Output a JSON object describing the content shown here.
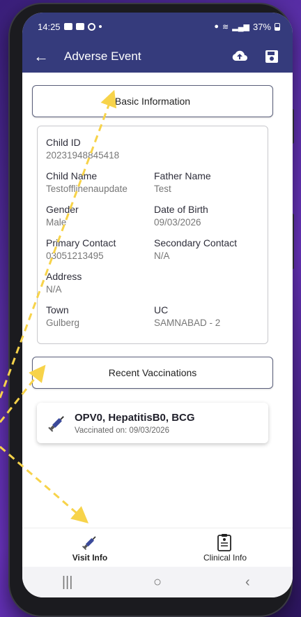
{
  "status": {
    "time": "14:25",
    "battery": "37%"
  },
  "appbar": {
    "title": "Adverse Event",
    "back_icon": "arrow-left-icon",
    "upload_icon": "cloud-upload-icon",
    "save_icon": "save-icon"
  },
  "basic_info": {
    "button_label": "Basic Information",
    "fields": {
      "child_id": {
        "label": "Child ID",
        "value": "20231948845418"
      },
      "child_name": {
        "label": "Child Name",
        "value": "Testofflinenaupdate"
      },
      "father_name": {
        "label": "Father Name",
        "value": "Test"
      },
      "gender": {
        "label": "Gender",
        "value": "Male"
      },
      "dob": {
        "label": "Date of Birth",
        "value": "09/03/2026"
      },
      "primary_contact": {
        "label": "Primary Contact",
        "value": "03051213495"
      },
      "secondary_contact": {
        "label": "Secondary Contact",
        "value": "N/A"
      },
      "address": {
        "label": "Address",
        "value": "N/A"
      },
      "town": {
        "label": "Town",
        "value": "Gulberg"
      },
      "uc": {
        "label": "UC",
        "value": "SAMNABAD - 2"
      }
    }
  },
  "recent": {
    "button_label": "Recent Vaccinations",
    "card": {
      "vaccines": "OPV0, HepatitisB0, BCG",
      "date_text": "Vaccinated on: 09/03/2026"
    }
  },
  "bottom_nav": [
    {
      "label": "Visit Info",
      "icon": "syringe-icon"
    },
    {
      "label": "Clinical Info",
      "icon": "clipboard-icon"
    }
  ],
  "colors": {
    "primary": "#353b7c",
    "arrow": "#f7d34a"
  }
}
